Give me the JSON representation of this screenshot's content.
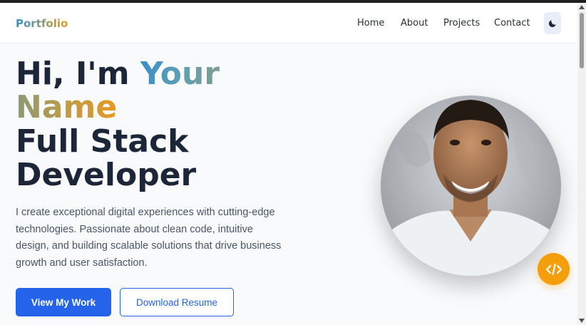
{
  "header": {
    "logo": "Portfolio",
    "nav": [
      {
        "label": "Home"
      },
      {
        "label": "About"
      },
      {
        "label": "Projects"
      },
      {
        "label": "Contact"
      }
    ],
    "theme_toggle_icon": "moon-icon"
  },
  "hero": {
    "greeting": "Hi, I'm ",
    "name_first": "Your",
    "name_last": "Name",
    "role_line1": "Full Stack",
    "role_line2": "Developer",
    "description": "I create exceptional digital experiences with cutting-edge technologies. Passionate about clean code, intuitive design, and building scalable solutions that drive business growth and user satisfaction.",
    "primary_button": "View My Work",
    "secondary_button": "Download Resume",
    "avatar_alt": "profile-photo",
    "badge_icon": "code-icon"
  },
  "colors": {
    "primary": "#2563eb",
    "accent": "#f59e0b",
    "heading": "#1c2638",
    "gradient_start": "#3b8fc7",
    "gradient_end": "#e69a22"
  }
}
